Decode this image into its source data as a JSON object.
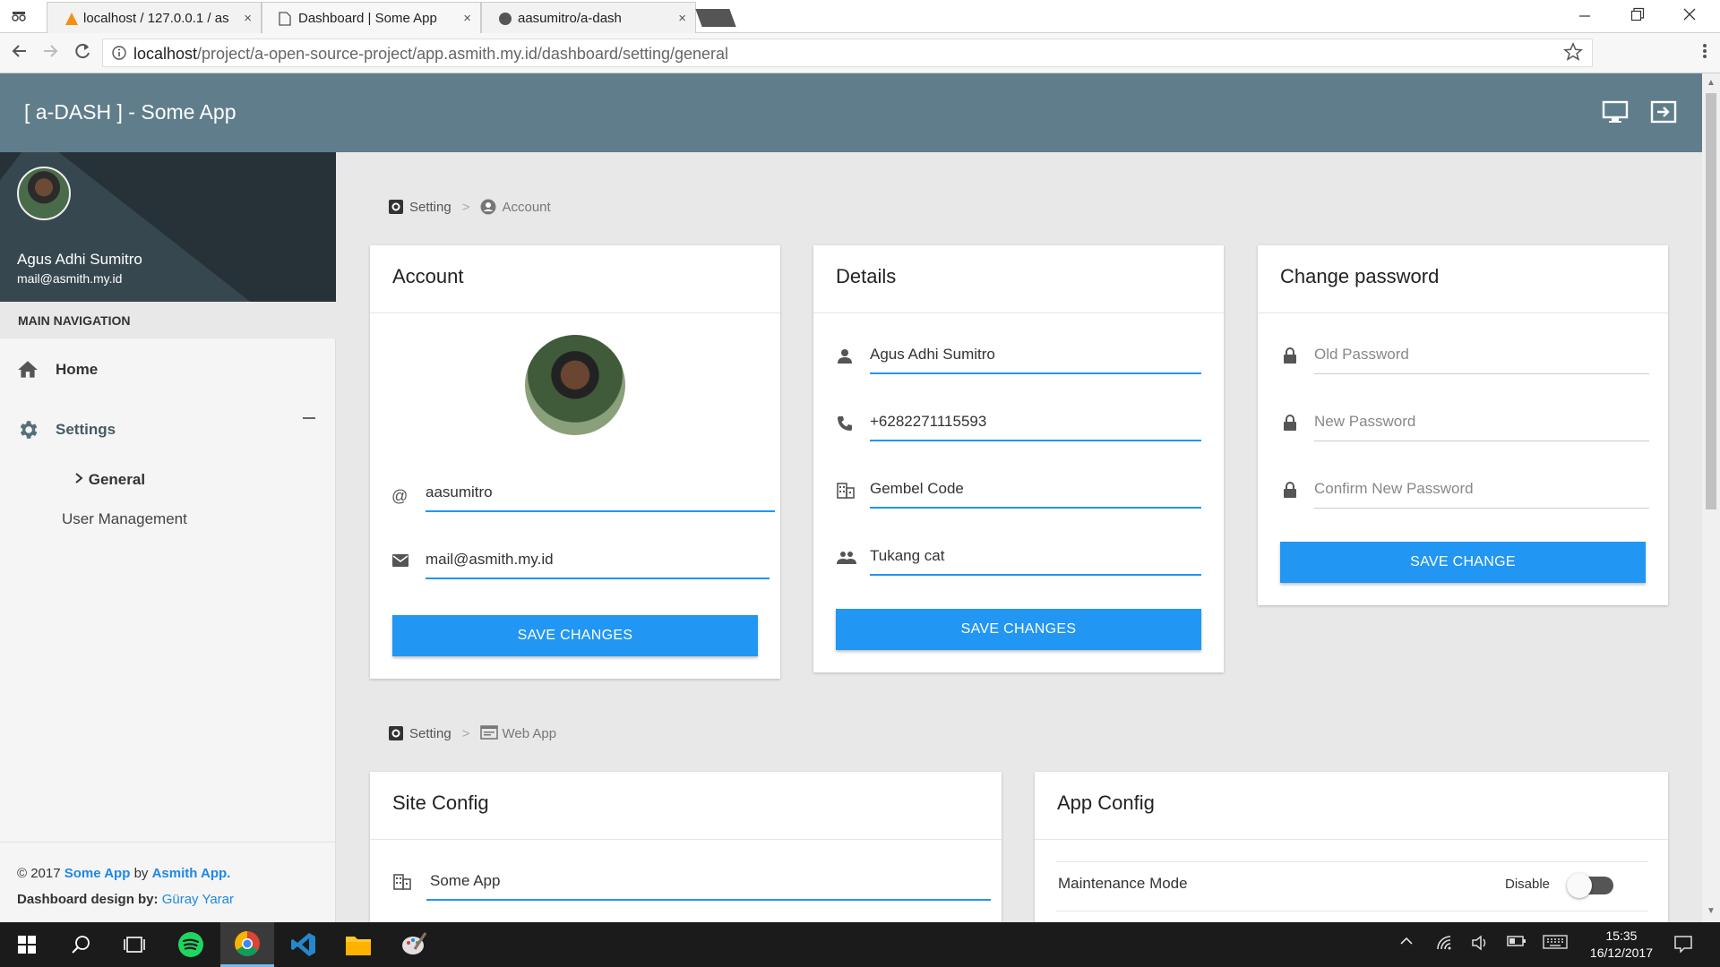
{
  "browser": {
    "tabs": [
      {
        "label": "localhost / 127.0.0.1 / as",
        "close": "×"
      },
      {
        "label": "Dashboard | Some App",
        "close": "×"
      },
      {
        "label": "aasumitro/a-dash",
        "close": "×"
      }
    ],
    "url_host": "localhost",
    "url_path": "/project/a-open-source-project/app.asmith.my.id/dashboard/setting/general"
  },
  "header": {
    "title": "[ a-DASH ] - Some App"
  },
  "sidebar": {
    "user_name": "Agus Adhi Sumitro",
    "user_email": "mail@asmith.my.id",
    "section_label": "MAIN NAVIGATION",
    "items": [
      {
        "label": "Home"
      },
      {
        "label": "Settings"
      }
    ],
    "subitems": [
      {
        "label": "General"
      },
      {
        "label": "User Management"
      }
    ],
    "footer": {
      "copyright": "© 2017",
      "app_name": "Some App",
      "by": "by",
      "company": "Asmith App.",
      "design_label": "Dashboard design by:",
      "designer": "Güray Yarar"
    }
  },
  "breadcrumb1": {
    "root": "Setting",
    "sep": ">",
    "current": "Account"
  },
  "breadcrumb2": {
    "root": "Setting",
    "sep": ">",
    "current": "Web App"
  },
  "account_card": {
    "title": "Account",
    "username": "aasumitro",
    "email": "mail@asmith.my.id",
    "save_label": "SAVE CHANGES"
  },
  "details_card": {
    "title": "Details",
    "name": "Agus Adhi Sumitro",
    "phone": "+6282271115593",
    "company": "Gembel Code",
    "job": "Tukang cat",
    "save_label": "SAVE CHANGES"
  },
  "password_card": {
    "title": "Change password",
    "old_placeholder": "Old Password",
    "new_placeholder": "New Password",
    "confirm_placeholder": "Confirm New Password",
    "save_label": "SAVE CHANGE"
  },
  "site_config": {
    "title": "Site Config",
    "site_name": "Some App"
  },
  "app_config": {
    "title": "App Config",
    "maintenance_label": "Maintenance Mode",
    "maintenance_state": "Disable"
  },
  "taskbar": {
    "time": "15:35",
    "date": "16/12/2017"
  },
  "colors": {
    "header_bg": "#607d8b",
    "profile_bg": "#263238",
    "accent": "#2196f3"
  }
}
